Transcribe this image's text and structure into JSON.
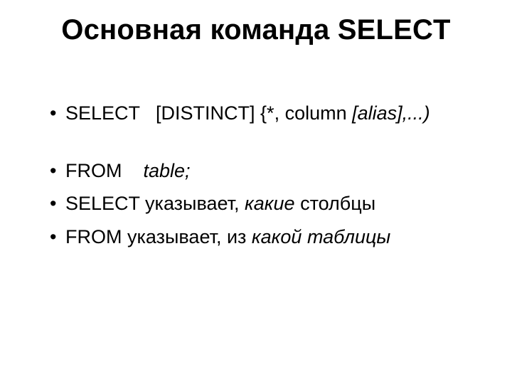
{
  "title": "Основная команда SELECT",
  "bullets": {
    "b1": {
      "kw": "SELECT",
      "part1": "[DISTINCT] {*, column",
      "italic_tail": " [alias],...)"
    },
    "b2": {
      "kw": "FROM",
      "italic": "table;"
    },
    "b3": {
      "prefix": "SELECT указывает, ",
      "italic": "какие",
      "suffix": " столбцы"
    },
    "b4": {
      "prefix": "FROM указывает, из ",
      "italic": "какой таблицы"
    }
  }
}
